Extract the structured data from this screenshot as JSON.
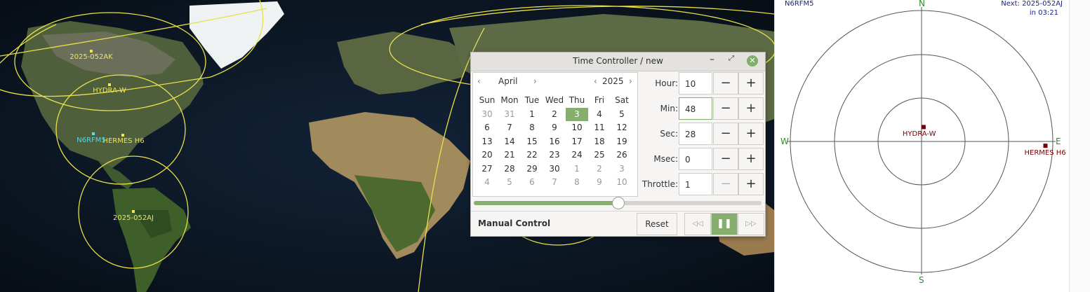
{
  "map": {
    "satellites": [
      {
        "name": "2025-052AK",
        "type": "sat"
      },
      {
        "name": "HYDRA-W",
        "type": "sat"
      },
      {
        "name": "HERMES H6",
        "type": "sat"
      },
      {
        "name": "2025-052AJ",
        "type": "sat"
      },
      {
        "name": "N6RFM5",
        "type": "qth"
      }
    ],
    "colors": {
      "footprint": "#e8e04a",
      "qth": "#52d6e6",
      "ocean": "#0f1c2b"
    }
  },
  "time_controller": {
    "title": "Time Controller / new",
    "window_buttons": {
      "minimize": "minimize-icon",
      "maximize": "maximize-icon",
      "close": "close-icon"
    },
    "calendar": {
      "month": "April",
      "year": "2025",
      "prev": "‹",
      "next": "›",
      "weekdays": [
        "Sun",
        "Mon",
        "Tue",
        "Wed",
        "Thu",
        "Fri",
        "Sat"
      ],
      "weeks": [
        [
          "30",
          "31",
          "1",
          "2",
          "3",
          "4",
          "5"
        ],
        [
          "6",
          "7",
          "8",
          "9",
          "10",
          "11",
          "12"
        ],
        [
          "13",
          "14",
          "15",
          "16",
          "17",
          "18",
          "19"
        ],
        [
          "20",
          "21",
          "22",
          "23",
          "24",
          "25",
          "26"
        ],
        [
          "27",
          "28",
          "29",
          "30",
          "1",
          "2",
          "3"
        ],
        [
          "4",
          "5",
          "6",
          "7",
          "8",
          "9",
          "10"
        ]
      ],
      "selected": "3"
    },
    "fields": [
      {
        "label": "Hour:",
        "value": "10"
      },
      {
        "label": "Min:",
        "value": "48"
      },
      {
        "label": "Sec:",
        "value": "28"
      },
      {
        "label": "Msec:",
        "value": "0"
      },
      {
        "label": "Throttle:",
        "value": "1"
      }
    ],
    "minus": "−",
    "plus": "+",
    "slider_fraction": 0.5,
    "mode": "Manual Control",
    "reset": "Reset",
    "playback": {
      "rewind": "◁◁",
      "pause": "❚❚",
      "forward": "▷▷"
    },
    "accent": "#86ae6f"
  },
  "polar": {
    "station": "N6RFM5",
    "next_line1": "Next: 2025-052AJ",
    "next_line2": "in 03:21",
    "compass": {
      "n": "N",
      "s": "S",
      "e": "E",
      "w": "W"
    },
    "satellites": [
      {
        "name": "HYDRA-W",
        "az": 8,
        "el": 80
      },
      {
        "name": "HERMES H6",
        "az": 92,
        "el": 5
      }
    ],
    "colors": {
      "compass": "#2e8b2e",
      "station": "#1a237e",
      "sat": "#7a0000"
    }
  }
}
